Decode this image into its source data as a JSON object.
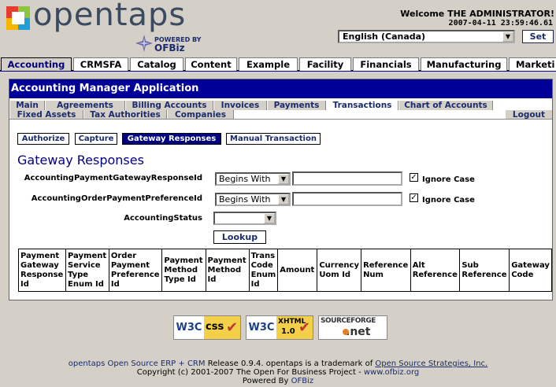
{
  "brand": {
    "logo_text": "opentaps",
    "powered_by": "POWERED BY",
    "ofbiz": "OFBiz"
  },
  "header": {
    "welcome": "Welcome THE ADMINISTRATOR!",
    "datetime": "2007-04-11 23:59:46.61",
    "locale_value": "English (Canada)",
    "set_label": "Set"
  },
  "main_tabs": [
    "Accounting",
    "CRMSFA",
    "Catalog",
    "Content",
    "Example",
    "Facility",
    "Financials",
    "Manufacturing",
    "Marketi"
  ],
  "app": {
    "title": "Accounting Manager Application",
    "subnav_row1": [
      "Main",
      "Agreements",
      "Billing Accounts",
      "Invoices",
      "Payments",
      "Transactions",
      "Chart of Accounts"
    ],
    "subnav_row2": [
      "Fixed Assets",
      "Tax Authorities",
      "Companies"
    ],
    "logout": "Logout",
    "buttons": [
      "Authorize",
      "Capture",
      "Gateway Responses",
      "Manual Transaction"
    ],
    "selected_button": "Gateway Responses"
  },
  "page": {
    "title": "Gateway Responses",
    "fields": {
      "gateway_response_label": "AccountingPaymentGatewayResponseId",
      "gateway_response_op": "Begins With",
      "order_pref_label": "AccountingOrderPaymentPreferenceId",
      "order_pref_op": "Begins With",
      "status_label": "AccountingStatus",
      "ignore_case_label": "Ignore Case"
    },
    "lookup_label": "Lookup",
    "table_headers": [
      "Payment Gateway Response Id",
      "Payment Service Type Enum Id",
      "Order Payment Preference Id",
      "Payment Method Type Id",
      "Payment Method Id",
      "Trans Code Enum Id",
      "Amount",
      "Currency Uom Id",
      "Reference Num",
      "Alt Reference",
      "Sub Reference",
      "Gateway Code"
    ]
  },
  "badges": {
    "w3c": "W3C",
    "css": "css",
    "xhtml": "XHTML",
    "xhtml_ver": "1.0",
    "sourceforge": "SOURCEFORGE",
    "net": ".net"
  },
  "footer": {
    "line1_a": "opentaps Open Source ERP + CRM",
    "line1_b": "Release 0.9.4. opentaps is a trademark of",
    "line1_link": "Open Source Strategies, Inc.",
    "line2_a": "Copyright (c) 2001-2007 The Open For Business Project -",
    "line2_link": "www.ofbiz.org",
    "line3_a": "Powered By",
    "line3_link": "OFBiz"
  },
  "colors": {
    "accent": "#000099",
    "link": "#1b2b6e",
    "background": "#d4d0c8"
  }
}
